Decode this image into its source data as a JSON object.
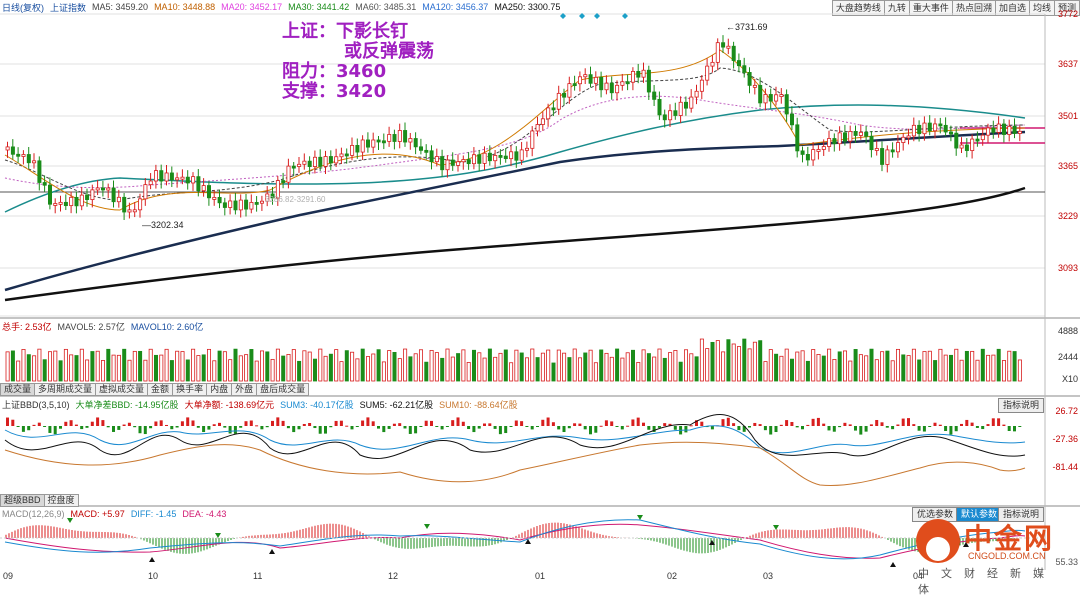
{
  "main_legend": {
    "title": "日线(复权)",
    "index": "上证指数",
    "ma5": "MA5: 3459.20",
    "ma10": "MA10: 3448.88",
    "ma20": "MA20: 3452.17",
    "ma30": "MA30: 3441.42",
    "ma60": "MA60: 3485.31",
    "ma120": "MA120: 3456.37",
    "ma250": "MA250: 3300.75"
  },
  "toolbar": [
    "大盘趋势线",
    "九转",
    "重大事件",
    "热点回溯",
    "加自选",
    "均线",
    "预测"
  ],
  "annotation": {
    "line1": "上证：下影长钉",
    "line2": "或反弹震荡",
    "line3": "阻力：3460",
    "line4": "支撑：3420"
  },
  "price_labels": {
    "high": "3731.69",
    "low": "3202.34",
    "range": "3286.82-3291.60"
  },
  "main_yaxis": [
    "3772",
    "3637",
    "3501",
    "3365",
    "3229",
    "3093"
  ],
  "volume_legend": {
    "total": "总手: 2.53亿",
    "mavol5": "MAVOL5: 2.57亿",
    "mavol10": "MAVOL10: 2.60亿"
  },
  "volume_yaxis": [
    "4888",
    "2444",
    "X10"
  ],
  "tabs": [
    "成交量",
    "多周期成交量",
    "虚拟成交量",
    "金额",
    "换手率",
    "内盘",
    "外盘",
    "盘后成交量"
  ],
  "bbd_legend": {
    "title": "上证BBD(3,5,10)",
    "bbd": "大单净差BBD: -14.95亿股",
    "net": "大单净额: -138.69亿元",
    "sum3": "SUM3: -40.17亿股",
    "sum5": "SUM5: -62.21亿股",
    "sum10": "SUM10: -88.64亿股"
  },
  "bbd_button": "指标说明",
  "bbd_yaxis": [
    "26.72",
    "-27.36",
    "-81.44"
  ],
  "bbd_tabs": [
    "超级BBD",
    "控盘度"
  ],
  "macd_legend": {
    "title": "MACD(12,26,9)",
    "macd": "MACD: +5.97",
    "diff": "DIFF: -1.45",
    "dea": "DEA: -4.43"
  },
  "macd_buttons": [
    "优选参数",
    "默认参数",
    "指标说明"
  ],
  "macd_yaxis": [
    "55.33"
  ],
  "xaxis": [
    "09",
    "10",
    "11",
    "12",
    "01",
    "02",
    "03",
    "04"
  ],
  "watermark": {
    "brand": "中金网",
    "url": "CNGOLD.COM.CN",
    "sub": "中文财经新媒体"
  },
  "colors": {
    "up": "#d81e1e",
    "down": "#1a8c1a",
    "annotation": "#a020c0",
    "watermark": "#e04d1c"
  }
}
